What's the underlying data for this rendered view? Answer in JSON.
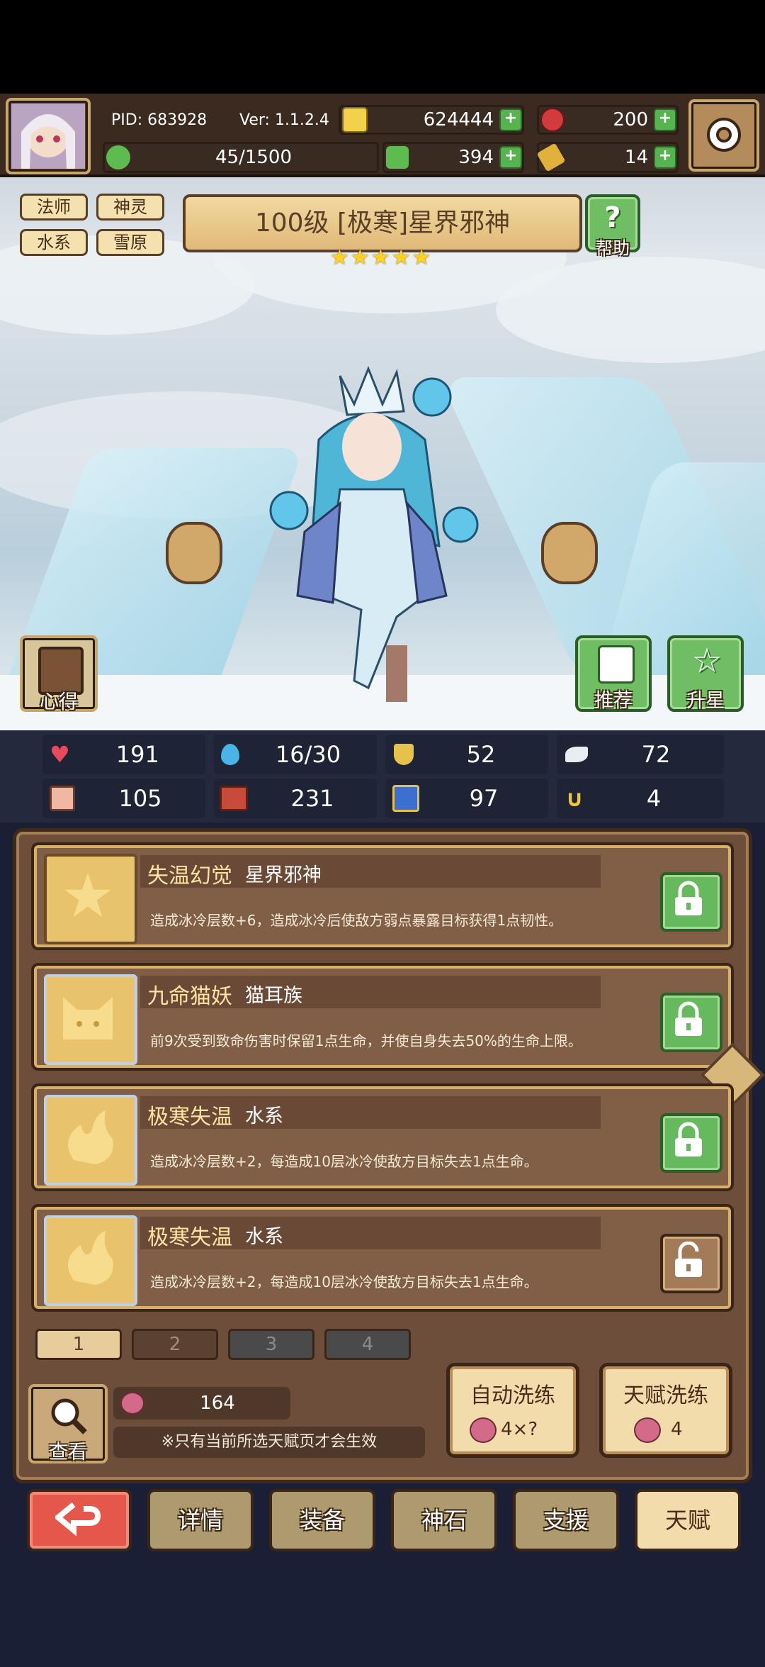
{
  "header": {
    "pid": "PID: 683928",
    "version": "Ver: 1.1.2.4",
    "gold": "624444",
    "gems": "200",
    "energy": "45/1500",
    "clovers": "394",
    "keys": "14"
  },
  "character": {
    "tags": [
      "法师",
      "神灵",
      "水系",
      "雪原"
    ],
    "title": "100级 [极寒]星界邪神",
    "stars": 5,
    "help_label": "帮助",
    "notes_label": "心得",
    "recommend_label": "推荐",
    "upgrade_label": "升星"
  },
  "stats": [
    {
      "icon": "heart-icon",
      "value": "191"
    },
    {
      "icon": "water-drop-icon",
      "value": "16/30"
    },
    {
      "icon": "shield-icon",
      "value": "52"
    },
    {
      "icon": "wing-icon",
      "value": "72"
    },
    {
      "icon": "fist-icon",
      "value": "105"
    },
    {
      "icon": "spellbook-icon",
      "value": "231"
    },
    {
      "icon": "speed-icon",
      "value": "97"
    },
    {
      "icon": "horseshoe-icon",
      "value": "4"
    }
  ],
  "talents": [
    {
      "name": "失温幻觉",
      "sub": "星界邪神",
      "desc": "造成冰冷层数+6，造成冰冷后使敌方弱点暴露目标获得1点韧性。",
      "locked": true
    },
    {
      "name": "九命猫妖",
      "sub": "猫耳族",
      "desc": "前9次受到致命伤害时保留1点生命，并使自身失去50%的生命上限。",
      "locked": true
    },
    {
      "name": "极寒失温",
      "sub": "水系",
      "desc": "造成冰冷层数+2，每造成10层冰冷使敌方目标失去1点生命。",
      "locked": true
    },
    {
      "name": "极寒失温",
      "sub": "水系",
      "desc": "造成冰冷层数+2，每造成10层冰冷使敌方目标失去1点生命。",
      "locked": false
    }
  ],
  "pages": [
    "1",
    "2",
    "3",
    "4"
  ],
  "footer": {
    "view_label": "查看",
    "count": "164",
    "note": "※只有当前所选天赋页才会生效",
    "auto_refine_label": "自动洗练",
    "auto_refine_cost": "4×?",
    "talent_refine_label": "天赋洗练",
    "talent_refine_cost": "4"
  },
  "nav": [
    "详情",
    "装备",
    "神石",
    "支援",
    "天赋"
  ],
  "colors": {
    "accent": "#d9b06a",
    "green": "#66b95c",
    "back": "#e5574a"
  }
}
